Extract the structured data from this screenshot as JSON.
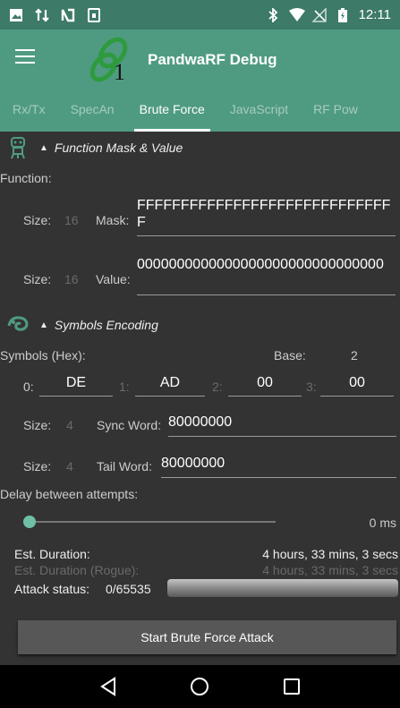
{
  "status_bar": {
    "left_icons": [
      "image-icon",
      "transfer-icon",
      "nfc-icon",
      "sim-icon"
    ],
    "right_icons": [
      "bluetooth-icon",
      "wifi-icon",
      "no-signal-icon",
      "battery-icon"
    ],
    "time": "12:11"
  },
  "app": {
    "title": "PandwaRF  Debug",
    "logo_text": "1",
    "accent_color": "#4f9b81"
  },
  "tabs": [
    {
      "label": "Rx/Tx",
      "active": false
    },
    {
      "label": "SpecAn",
      "active": false
    },
    {
      "label": "Brute Force",
      "active": true
    },
    {
      "label": "JavaScript",
      "active": false
    },
    {
      "label": "RF Pow",
      "active": false
    }
  ],
  "function_section": {
    "header": "Function Mask & Value",
    "function_label": "Function:",
    "mask_size_label": "Size:",
    "mask_size_value": "16",
    "mask_label": "Mask:",
    "mask_value": "FFFFFFFFFFFFFFFFFFFFFFFFFFFFFF",
    "value_size_label": "Size:",
    "value_size_value": "16",
    "value_label": "Value:",
    "value_value": "0000000000000000000000000000000"
  },
  "symbols_section": {
    "header": "Symbols Encoding",
    "symbols_label": "Symbols (Hex):",
    "base_label": "Base:",
    "base_value": "2",
    "symbols": [
      {
        "label": "0:",
        "value": "DE"
      },
      {
        "label": "1:",
        "value": "AD"
      },
      {
        "label": "2:",
        "value": "00"
      },
      {
        "label": "3:",
        "value": "00"
      }
    ],
    "sync_size_label": "Size:",
    "sync_size_value": "4",
    "sync_label": "Sync Word:",
    "sync_value": "80000000",
    "tail_size_label": "Size:",
    "tail_size_value": "4",
    "tail_label": "Tail Word:",
    "tail_value": "80000000"
  },
  "delay": {
    "label": "Delay between attempts:",
    "value_text": "0 ms",
    "slider_fraction": 0
  },
  "duration": {
    "est_label": "Est. Duration:",
    "est_value": "4 hours, 33 mins, 3 secs",
    "rogue_label": "Est. Duration (Rogue):",
    "rogue_value": "4 hours, 33 mins, 3 secs"
  },
  "attack": {
    "status_label": "Attack status:",
    "status_value": "0/65535",
    "progress_fraction": 0
  },
  "start_button": "Start Brute Force Attack",
  "nav": [
    "back-icon",
    "home-icon",
    "recents-icon"
  ]
}
